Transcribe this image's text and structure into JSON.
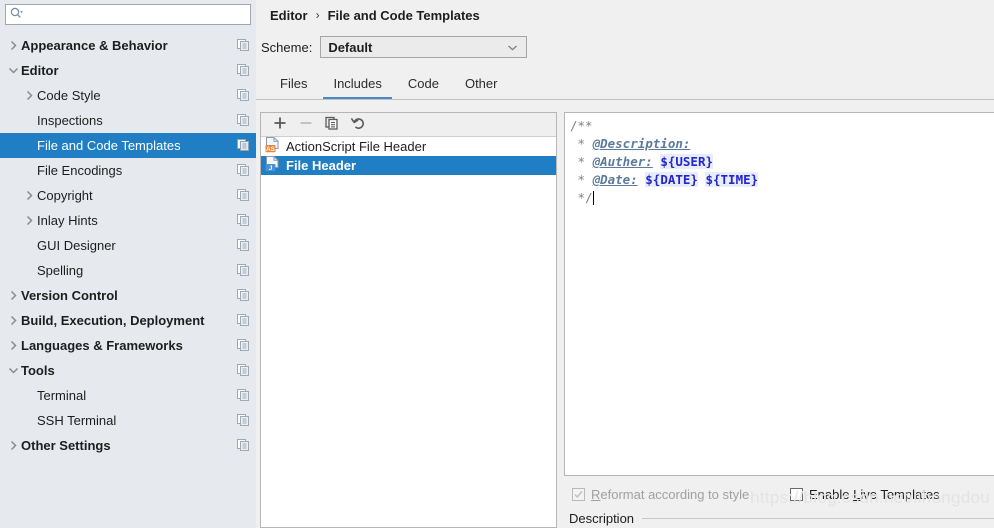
{
  "search": {
    "placeholder": "",
    "value": "",
    "icon": "search-icon"
  },
  "sidebar": {
    "items": [
      {
        "label": "Appearance & Behavior",
        "level": 0,
        "bold": true,
        "arrow": "right",
        "selected": false,
        "copy": true
      },
      {
        "label": "Editor",
        "level": 0,
        "bold": true,
        "arrow": "down",
        "selected": false,
        "copy": true
      },
      {
        "label": "Code Style",
        "level": 1,
        "bold": false,
        "arrow": "right",
        "selected": false,
        "copy": true
      },
      {
        "label": "Inspections",
        "level": 1,
        "bold": false,
        "arrow": "none",
        "selected": false,
        "copy": true
      },
      {
        "label": "File and Code Templates",
        "level": 1,
        "bold": false,
        "arrow": "none",
        "selected": true,
        "copy": true
      },
      {
        "label": "File Encodings",
        "level": 1,
        "bold": false,
        "arrow": "none",
        "selected": false,
        "copy": true
      },
      {
        "label": "Copyright",
        "level": 1,
        "bold": false,
        "arrow": "right",
        "selected": false,
        "copy": true
      },
      {
        "label": "Inlay Hints",
        "level": 1,
        "bold": false,
        "arrow": "right",
        "selected": false,
        "copy": true
      },
      {
        "label": "GUI Designer",
        "level": 1,
        "bold": false,
        "arrow": "none",
        "selected": false,
        "copy": true
      },
      {
        "label": "Spelling",
        "level": 1,
        "bold": false,
        "arrow": "none",
        "selected": false,
        "copy": true
      },
      {
        "label": "Version Control",
        "level": 0,
        "bold": true,
        "arrow": "right",
        "selected": false,
        "copy": true
      },
      {
        "label": "Build, Execution, Deployment",
        "level": 0,
        "bold": true,
        "arrow": "right",
        "selected": false,
        "copy": true
      },
      {
        "label": "Languages & Frameworks",
        "level": 0,
        "bold": true,
        "arrow": "right",
        "selected": false,
        "copy": true
      },
      {
        "label": "Tools",
        "level": 0,
        "bold": true,
        "arrow": "down",
        "selected": false,
        "copy": true
      },
      {
        "label": "Terminal",
        "level": 1,
        "bold": false,
        "arrow": "none",
        "selected": false,
        "copy": true
      },
      {
        "label": "SSH Terminal",
        "level": 1,
        "bold": false,
        "arrow": "none",
        "selected": false,
        "copy": true
      },
      {
        "label": "Other Settings",
        "level": 0,
        "bold": true,
        "arrow": "right",
        "selected": false,
        "copy": true
      }
    ]
  },
  "breadcrumb": {
    "root": "Editor",
    "separator": "›",
    "current": "File and Code Templates"
  },
  "scheme": {
    "label": "Scheme:",
    "value": "Default",
    "chevron_icon": "chevron-down-icon"
  },
  "tabs": [
    {
      "label": "Files",
      "active": false
    },
    {
      "label": "Includes",
      "active": true
    },
    {
      "label": "Code",
      "active": false
    },
    {
      "label": "Other",
      "active": false
    }
  ],
  "list_toolbar": [
    {
      "name": "add-template-button",
      "icon": "plus-icon",
      "enabled": true
    },
    {
      "name": "remove-template-button",
      "icon": "minus-icon",
      "enabled": false
    },
    {
      "name": "copy-template-button",
      "icon": "copy-icon",
      "enabled": true
    },
    {
      "name": "reset-template-button",
      "icon": "undo-icon",
      "enabled": true
    }
  ],
  "templates": [
    {
      "name": "ActionScript File Header",
      "badge": "AS",
      "badge_color": "#e8833a",
      "selected": false
    },
    {
      "name": "File Header",
      "badge": "J",
      "badge_color": "#4a90d9",
      "selected": true
    }
  ],
  "editor": {
    "lines": [
      [
        {
          "t": "comment",
          "v": "/**"
        }
      ],
      [
        {
          "t": "comment",
          "v": " * "
        },
        {
          "t": "tag",
          "v": "@Description:"
        }
      ],
      [
        {
          "t": "comment",
          "v": " * "
        },
        {
          "t": "tag",
          "v": "@Auther:"
        },
        {
          "t": "comment",
          "v": " "
        },
        {
          "t": "var",
          "v": "${USER}"
        }
      ],
      [
        {
          "t": "comment",
          "v": " * "
        },
        {
          "t": "tag",
          "v": "@Date:"
        },
        {
          "t": "comment",
          "v": " "
        },
        {
          "t": "var",
          "v": "${DATE}"
        },
        {
          "t": "comment",
          "v": " "
        },
        {
          "t": "var",
          "v": "${TIME}"
        }
      ],
      [
        {
          "t": "comment",
          "v": " */"
        },
        {
          "t": "caret",
          "v": ""
        }
      ]
    ]
  },
  "options": {
    "reformat": {
      "label_pre": "",
      "label_mn": "R",
      "label_post": "eformat according to style",
      "checked": true,
      "enabled": false
    },
    "live_templates": {
      "label_pre": "Enable ",
      "label_mn": "L",
      "label_post": "ive Templates",
      "checked": false,
      "enabled": true
    }
  },
  "description": {
    "label": "Description"
  },
  "watermark": {
    "text": "https://blog.csdn.net/lihongdou"
  },
  "colors": {
    "selection": "#1f7ec4",
    "sidebar_bg": "#e6eaee",
    "panel_bg": "#f0f0f0",
    "tab_underline": "#4a88c7",
    "var_blue": "#2525cc",
    "tag_blue": "#5c7b9c"
  }
}
